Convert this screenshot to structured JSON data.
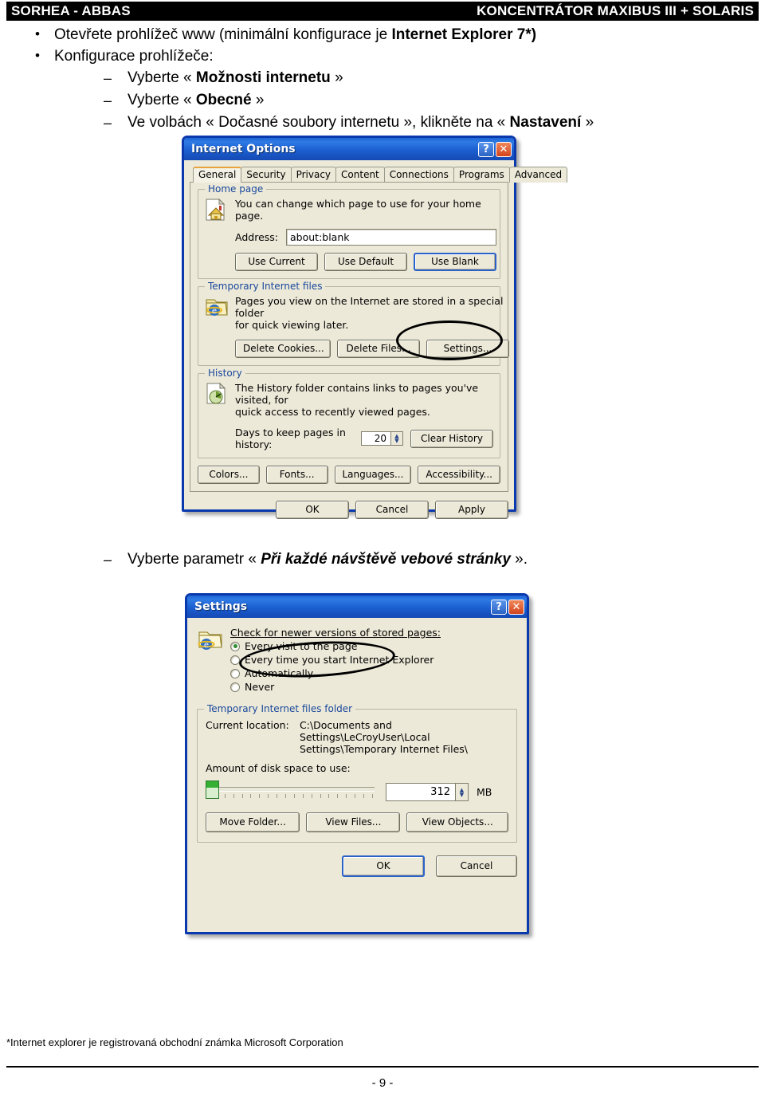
{
  "header": {
    "left": "SORHEA - ABBAS",
    "right": "KONCENTRÁTOR MAXIBUS III + SOLARIS"
  },
  "bullets": [
    {
      "text_before": "Otevřete prohlížeč www (minimální konfigurace je ",
      "bold": "Internet Explorer 7*)",
      "text_after": ""
    },
    {
      "text_before": "Konfigurace prohlížeče:",
      "bold": "",
      "text_after": ""
    }
  ],
  "subbullets": [
    {
      "before": "Vyberte  « ",
      "bold": "Možnosti internetu",
      "after": " »"
    },
    {
      "before": "Vyberte « ",
      "bold": "Obecné",
      "after": " »"
    },
    {
      "before": "Ve volbách « Dočasné soubory internetu », klikněte na  « ",
      "bold": "Nastavení",
      "after": " »"
    }
  ],
  "mid_instruction": {
    "before": "Vyberte parametr « ",
    "bold": "Při každé návštěvě vebové stránky",
    "after": " »."
  },
  "internet_options": {
    "title": "Internet Options",
    "help_label": "?",
    "close_label": "✕",
    "tabs": [
      {
        "label": "General",
        "active": true
      },
      {
        "label": "Security",
        "active": false
      },
      {
        "label": "Privacy",
        "active": false
      },
      {
        "label": "Content",
        "active": false
      },
      {
        "label": "Connections",
        "active": false
      },
      {
        "label": "Programs",
        "active": false
      },
      {
        "label": "Advanced",
        "active": false
      }
    ],
    "home_page": {
      "group_label": "Home page",
      "description": "You can change which page to use for your home page.",
      "address_label": "Address:",
      "address_value": "about:blank",
      "buttons": [
        "Use Current",
        "Use Default",
        "Use Blank"
      ]
    },
    "temp_files": {
      "group_label": "Temporary Internet files",
      "description_line1": "Pages you view on the Internet are stored in a special folder",
      "description_line2": "for quick viewing later.",
      "buttons": [
        "Delete Cookies...",
        "Delete Files...",
        "Settings..."
      ]
    },
    "history": {
      "group_label": "History",
      "description_line1": "The History folder contains links to pages you've visited, for",
      "description_line2": "quick access to recently viewed pages.",
      "days_label": "Days to keep pages in history:",
      "days_value": "20",
      "clear_button": "Clear History"
    },
    "bottom_buttons": [
      "Colors...",
      "Fonts...",
      "Languages...",
      "Accessibility..."
    ],
    "dialog_buttons": [
      "OK",
      "Cancel",
      "Apply"
    ]
  },
  "settings_dialog": {
    "title": "Settings",
    "help_label": "?",
    "close_label": "✕",
    "check_label": "Check for newer versions of stored pages:",
    "radios": [
      {
        "label": "Every visit to the page",
        "selected": true
      },
      {
        "label": "Every time you start Internet Explorer",
        "selected": false
      },
      {
        "label": "Automatically",
        "selected": false
      },
      {
        "label": "Never",
        "selected": false
      }
    ],
    "folder_group": {
      "group_label": "Temporary Internet files folder",
      "current_location_label": "Current location:",
      "current_location_line1": "C:\\Documents and",
      "current_location_line2": "Settings\\LeCroyUser\\Local",
      "current_location_line3": "Settings\\Temporary Internet Files\\",
      "disk_label": "Amount of disk space to use:",
      "disk_value": "312",
      "disk_unit": "MB",
      "buttons": [
        "Move Folder...",
        "View Files...",
        "View Objects..."
      ]
    },
    "dialog_buttons": [
      "OK",
      "Cancel"
    ]
  },
  "footnote": "*Internet explorer je registrovaná obchodní známka Microsoft Corporation",
  "page_number": "- 9 -"
}
